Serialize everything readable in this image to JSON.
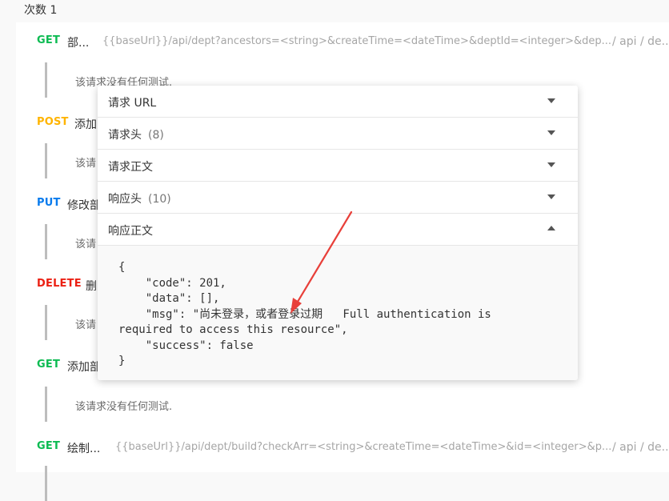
{
  "run": {
    "title": "次数 1"
  },
  "requests": [
    {
      "method": "GET",
      "name": "部...",
      "url": "{{baseUrl}}/api/dept?ancestors=<string>&createTime=<dateTime>&deptId=<integer>&dep...",
      "path": "/ api / de..."
    },
    {
      "method": "POST",
      "name": "添加"
    },
    {
      "method": "PUT",
      "name": "修改部"
    },
    {
      "method": "DELETE",
      "name": "删"
    },
    {
      "method": "GET",
      "name": "添加部"
    },
    {
      "method": "GET",
      "name": "绘制...",
      "url": "{{baseUrl}}/api/dept/build?checkArr=<string>&createTime=<dateTime>&id=<integer>&p...",
      "path": "/ api / de..."
    }
  ],
  "tests": {
    "full": "该请求没有任何测试.",
    "partial_first": "该请求没有任何测试.",
    "short": "该请"
  },
  "popover": {
    "sections": [
      {
        "title": "请求 URL",
        "count": ""
      },
      {
        "title": "请求头",
        "count": "(8)"
      },
      {
        "title": "请求正文",
        "count": ""
      },
      {
        "title": "响应头",
        "count": "(10)"
      },
      {
        "title": "响应正文",
        "count": ""
      }
    ],
    "response_body": "{\n    \"code\": 201,\n    \"data\": [],\n    \"msg\": \"尚未登录，或者登录过期   Full authentication is\nrequired to access this resource\",\n    \"success\": false\n}"
  },
  "colors": {
    "get": "#0cbb52",
    "post": "#ffb400",
    "put": "#097bed",
    "delete": "#eb2013",
    "annotation_arrow": "#e8403a"
  }
}
